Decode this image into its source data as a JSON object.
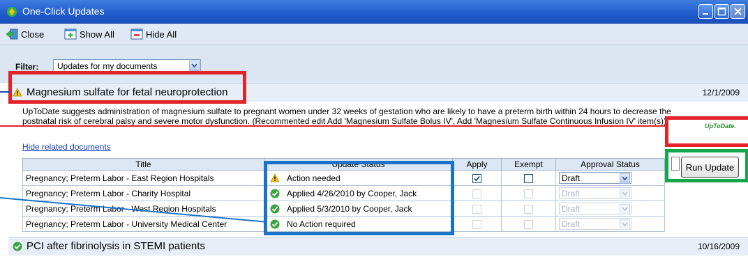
{
  "window": {
    "title": "One-Click Updates"
  },
  "toolbar": {
    "close_label": "Close",
    "show_all_label": "Show All",
    "hide_all_label": "Hide All"
  },
  "filter": {
    "label": "Filter:",
    "selected": "Updates for my documents"
  },
  "updates": [
    {
      "title": "Magnesium sulfate for fetal neuroprotection",
      "date": "12/1/2009",
      "status_icon": "warning-icon",
      "description": "UpToDate suggests administration of magnesium sulfate to pregnant women under 32 weeks of gestation who are likely to have a preterm birth within 24 hours to decrease the postnatal risk of cerebral palsy and severe motor dysfunction.  (Recommented edit Add 'Magnesium Sulfate Bolus IV', Add 'Magnesium Sulfate Continuous Infusion IV'  item(s))",
      "hide_link": "Hide related documents",
      "logo_text": "UpToDate."
    },
    {
      "title": "PCI after fibrinolysis in STEMI patients",
      "date": "10/16/2009",
      "status_icon": "check-circle-icon"
    }
  ],
  "table": {
    "headers": [
      "Title",
      "Update Status",
      "Apply",
      "Exempt",
      "Approval Status"
    ],
    "rows": [
      {
        "title": "Pregnancy; Preterm Labor - East Region Hospitals",
        "status": "Action needed",
        "status_icon": "warning-icon",
        "apply": true,
        "apply_enabled": true,
        "exempt": false,
        "exempt_enabled": true,
        "approval": "Draft",
        "approval_enabled": true
      },
      {
        "title": "Pregnancy; Preterm Labor - Charity Hospital",
        "status": "Applied 4/26/2010 by Cooper, Jack",
        "status_icon": "check-circle-icon",
        "apply": false,
        "apply_enabled": false,
        "exempt": false,
        "exempt_enabled": false,
        "approval": "Draft",
        "approval_enabled": false
      },
      {
        "title": "Pregnancy; Preterm Labor - West Region Hospitals",
        "status": "Applied 5/3/2010 by Cooper, Jack",
        "status_icon": "check-circle-icon",
        "apply": false,
        "apply_enabled": false,
        "exempt": false,
        "exempt_enabled": false,
        "approval": "Draft",
        "approval_enabled": false
      },
      {
        "title": "Pregnancy; Preterm Labor - University Medical Center",
        "status": "No Action required",
        "status_icon": "check-circle-icon",
        "apply": false,
        "apply_enabled": false,
        "exempt": false,
        "exempt_enabled": false,
        "approval": "Draft",
        "approval_enabled": false
      }
    ]
  },
  "run_update_label": "Run Update",
  "colors": {
    "highlight_red": "#e2232a",
    "highlight_green": "#14a64a",
    "highlight_blue": "#1a73c8",
    "title_bar": "#1f5ac9"
  }
}
